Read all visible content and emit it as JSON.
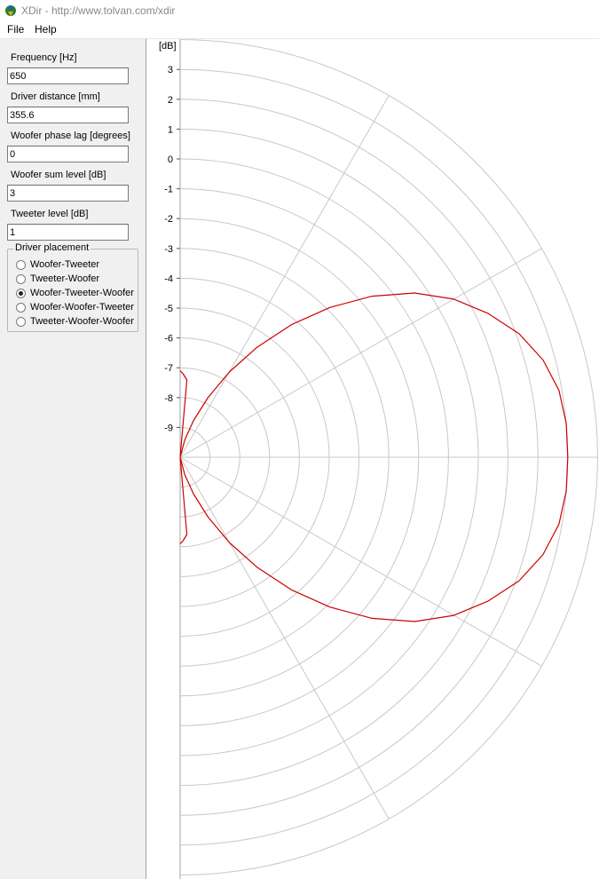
{
  "window": {
    "title": "XDir - http://www.tolvan.com/xdir",
    "app_icon": "xdir-app-icon"
  },
  "menu": {
    "items": [
      "File",
      "Help"
    ]
  },
  "panel": {
    "frequency": {
      "label": "Frequency [Hz]",
      "value": "650"
    },
    "driver_distance": {
      "label": "Driver distance [mm]",
      "value": "355.6"
    },
    "woofer_phase_lag": {
      "label": "Woofer phase lag [degrees]",
      "value": "0"
    },
    "woofer_sum_level": {
      "label": "Woofer sum level [dB]",
      "value": "3"
    },
    "tweeter_level": {
      "label": "Tweeter level [dB]",
      "value": "1"
    },
    "driver_placement": {
      "legend": "Driver placement",
      "options": [
        "Woofer-Tweeter",
        "Tweeter-Woofer",
        "Woofer-Tweeter-Woofer",
        "Woofer-Woofer-Tweeter",
        "Tweeter-Woofer-Woofer"
      ],
      "selected": "Woofer-Tweeter-Woofer"
    }
  },
  "chart_data": {
    "type": "polar",
    "unit_label": "[dB]",
    "radial_ticks": [
      "3",
      "2",
      "1",
      "0",
      "-1",
      "-2",
      "-3",
      "-4",
      "-5",
      "-6",
      "-7",
      "-8",
      "-9"
    ],
    "rlim": [
      -10,
      4
    ],
    "angle_range_deg": [
      -90,
      90
    ],
    "spoke_angles_deg": [
      -60,
      -30,
      0,
      30,
      60
    ],
    "grid": true,
    "curve_color": "#cc0000",
    "grid_color": "#c8c8c8",
    "series": [
      {
        "angle_deg": [
          0,
          5,
          10,
          15,
          20,
          25,
          30,
          35,
          40,
          45,
          50,
          55,
          60,
          65,
          70,
          75,
          80,
          85,
          88,
          90
        ],
        "level_db": [
          3,
          3,
          2.9,
          2.6,
          2.1,
          1.4,
          0.6,
          -0.4,
          -1.6,
          -2.9,
          -4.2,
          -5.5,
          -6.7,
          -7.8,
          -8.7,
          -9.4,
          -10,
          -7.4,
          -7.2,
          -7.1
        ]
      }
    ]
  }
}
